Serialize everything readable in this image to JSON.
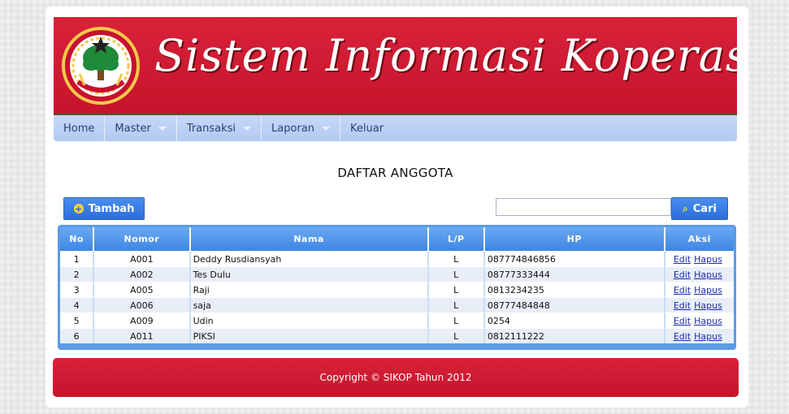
{
  "banner": {
    "title": "Sistem Informasi Koperasi",
    "logo_text": "KOPERASI INDONESIA",
    "colors": {
      "red": "#d01a31",
      "green": "#0d8a2f"
    }
  },
  "nav": {
    "items": [
      {
        "label": "Home",
        "has_dropdown": false
      },
      {
        "label": "Master",
        "has_dropdown": true
      },
      {
        "label": "Transaksi",
        "has_dropdown": true
      },
      {
        "label": "Laporan",
        "has_dropdown": true
      },
      {
        "label": "Keluar",
        "has_dropdown": false
      }
    ]
  },
  "page_title": "DAFTAR ANGGOTA",
  "toolbar": {
    "add_label": "Tambah",
    "search_label": "Cari",
    "search_value": "",
    "search_placeholder": ""
  },
  "table": {
    "headers": [
      "No",
      "Nomor",
      "Nama",
      "L/P",
      "HP",
      "Aksi"
    ],
    "rows": [
      {
        "no": "1",
        "nomor": "A001",
        "nama": "Deddy Rusdiansyah",
        "lp": "L",
        "hp": "087774846856"
      },
      {
        "no": "2",
        "nomor": "A002",
        "nama": "Tes Dulu",
        "lp": "L",
        "hp": "08777333444"
      },
      {
        "no": "3",
        "nomor": "A005",
        "nama": "Raji",
        "lp": "L",
        "hp": "0813234235"
      },
      {
        "no": "4",
        "nomor": "A006",
        "nama": "saja",
        "lp": "L",
        "hp": "08777484848"
      },
      {
        "no": "5",
        "nomor": "A009",
        "nama": "Udin",
        "lp": "L",
        "hp": "0254"
      },
      {
        "no": "6",
        "nomor": "A011",
        "nama": "PIKSI",
        "lp": "L",
        "hp": "0812111222"
      }
    ],
    "edit_label": "Edit",
    "delete_label": "Hapus"
  },
  "footer": {
    "text": "Copyright © SIKOP Tahun 2012"
  }
}
